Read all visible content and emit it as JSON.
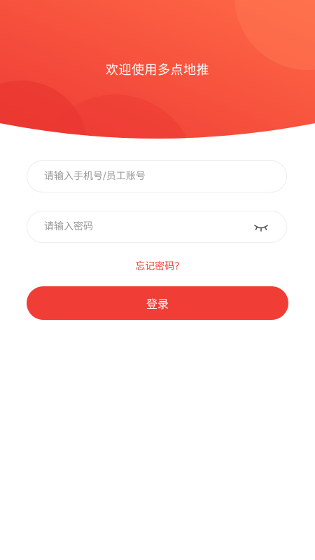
{
  "header": {
    "welcome_text": "欢迎使用多点地推",
    "gradient_start": "#ef3b33",
    "gradient_end": "#ff6d45"
  },
  "login_form": {
    "account_placeholder": "请输入手机号/员工账号",
    "account_value": "",
    "password_placeholder": "请输入密码",
    "password_value": "",
    "password_toggle_icon": "eye-closed-icon",
    "forgot_password_label": "忘记密码?",
    "login_button_label": "登录",
    "accent_color": "#f03d36"
  }
}
